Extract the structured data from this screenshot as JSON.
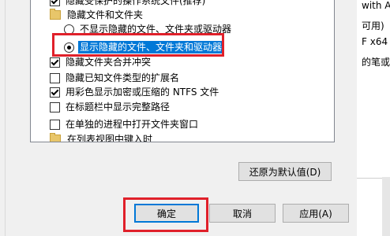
{
  "tree": {
    "items": [
      {
        "kind": "checkbox",
        "checked": true,
        "label": "隐藏受保护的操作系统文件(推荐)"
      },
      {
        "kind": "folder",
        "label": "隐藏文件和文件夹"
      },
      {
        "kind": "radio",
        "checked": false,
        "label": "不显示隐藏的文件、文件夹或驱动器"
      },
      {
        "kind": "radio",
        "checked": true,
        "label": "显示隐藏的文件、文件夹和驱动器"
      },
      {
        "kind": "checkbox",
        "checked": true,
        "label": "隐藏文件夹合并冲突"
      },
      {
        "kind": "checkbox",
        "checked": false,
        "label": "隐藏已知文件类型的扩展名"
      },
      {
        "kind": "checkbox",
        "checked": true,
        "label": "用彩色显示加密或压缩的 NTFS 文件"
      },
      {
        "kind": "checkbox",
        "checked": false,
        "label": "在标题栏中显示完整路径"
      },
      {
        "kind": "checkbox",
        "checked": false,
        "label": "在单独的进程中打开文件夹窗口"
      },
      {
        "kind": "folder",
        "label": "在列表视图中键入时"
      }
    ]
  },
  "buttons": {
    "restore_defaults": "还原为默认值(D)",
    "ok": "确定",
    "cancel": "取消",
    "apply": "应用(A)"
  },
  "background_text": {
    "line1": "with A",
    "line2": "可用)",
    "line3": "F x64",
    "line4": "的笔或"
  }
}
